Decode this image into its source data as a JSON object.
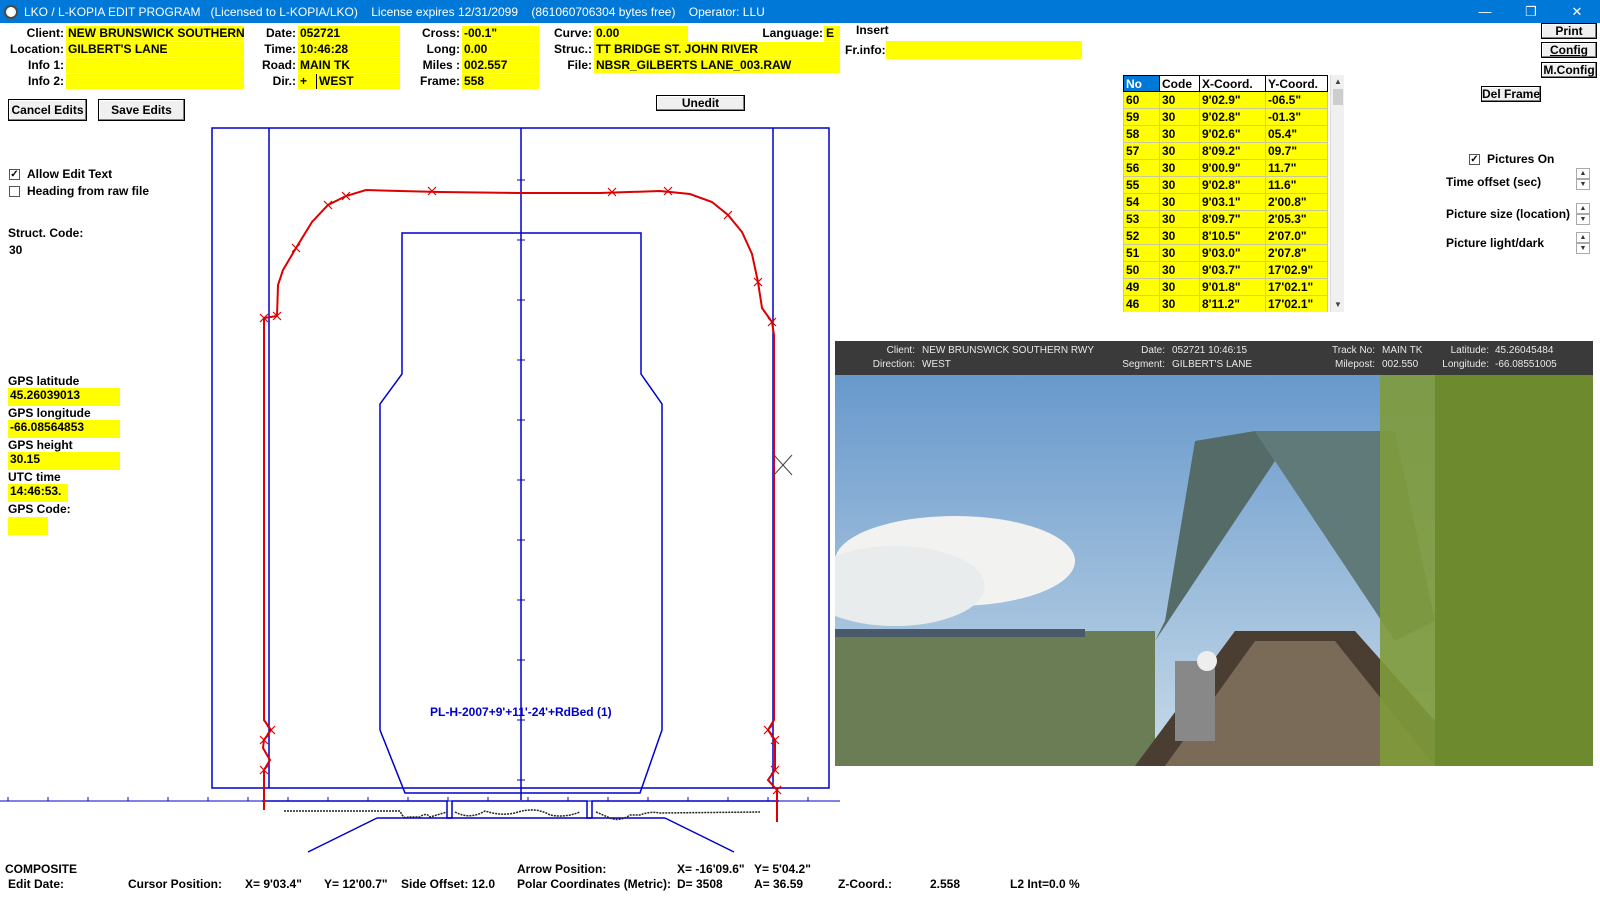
{
  "window": {
    "title": "LKO / L-KOPIA EDIT PROGRAM   (Licensed to L-KOPIA/LKO)    License expires 12/31/2099    (861060706304 bytes free)    Operator: LLU",
    "minimize": "—",
    "restore": "❐",
    "close": "✕"
  },
  "header": {
    "client_label": "Client:",
    "client": "NEW BRUNSWICK SOUTHERN",
    "location_label": "Location:",
    "location": "GILBERT'S LANE",
    "info1_label": "Info 1:",
    "info1": "",
    "info2_label": "Info 2:",
    "info2": "",
    "date_label": "Date:",
    "date": "052721",
    "time_label": "Time:",
    "time": "10:46:28",
    "road_label": "Road:",
    "road": "MAIN TK",
    "dir_label": "Dir.:",
    "dir_sign": "+",
    "dir": "WEST",
    "cross_label": "Cross:",
    "cross": "-00.1\"",
    "long_label": "Long:",
    "long": "0.00",
    "miles_label": "Miles :",
    "miles": "002.557",
    "frame_label": "Frame:",
    "frame": "558",
    "curve_label": "Curve:",
    "curve": "0.00",
    "struc_label": "Struc.:",
    "struc": "TT BRIDGE ST. JOHN RIVER",
    "file_label": "File:",
    "file": "NBSR_GILBERTS LANE_003.RAW",
    "language_label": "Language:",
    "language": "E",
    "insert_label": "Insert",
    "frinfo_label": "Fr.info:",
    "frinfo": ""
  },
  "buttons": {
    "cancel_edits": "Cancel Edits",
    "save_edits": "Save Edits",
    "unedit": "Unedit",
    "print": "Print",
    "config": "Config",
    "mconfig": "M.Config",
    "del_frame": "Del Frame"
  },
  "left_panel": {
    "allow_edit_text": "Allow Edit Text",
    "allow_edit_checked": true,
    "heading_from_raw": "Heading from raw file",
    "heading_checked": false,
    "struct_code_label": "Struct. Code:",
    "struct_code": "30",
    "gps_latitude_label": "GPS latitude",
    "gps_latitude": "45.26039013",
    "gps_longitude_label": "GPS longitude",
    "gps_longitude": "-66.08564853",
    "gps_height_label": "GPS height",
    "gps_height": "30.15",
    "utc_time_label": "UTC time",
    "utc_time": "14:46:53.",
    "gps_code_label": "GPS Code:",
    "gps_code": ""
  },
  "profile": {
    "label": "PL-H-2007+9'+11'-24'+RdBed  (1)",
    "color_measured": "#dd0000",
    "color_clearance": "#0000cc"
  },
  "points_table": {
    "headers": [
      "No",
      "Code",
      "X-Coord.",
      "Y-Coord."
    ],
    "rows": [
      [
        "60",
        "30",
        "9'02.9\"",
        "-06.5\""
      ],
      [
        "59",
        "30",
        "9'02.8\"",
        "-01.3\""
      ],
      [
        "58",
        "30",
        "9'02.6\"",
        "05.4\""
      ],
      [
        "57",
        "30",
        "8'09.2\"",
        "09.7\""
      ],
      [
        "56",
        "30",
        "9'00.9\"",
        "11.7\""
      ],
      [
        "55",
        "30",
        "9'02.8\"",
        "11.6\""
      ],
      [
        "54",
        "30",
        "9'03.1\"",
        "2'00.8\""
      ],
      [
        "53",
        "30",
        "8'09.7\"",
        "2'05.3\""
      ],
      [
        "52",
        "30",
        "8'10.5\"",
        "2'07.0\""
      ],
      [
        "51",
        "30",
        "9'03.0\"",
        "2'07.8\""
      ],
      [
        "50",
        "30",
        "9'03.7\"",
        "17'02.9\""
      ],
      [
        "49",
        "30",
        "9'01.8\"",
        "17'02.1\""
      ],
      [
        "46",
        "30",
        "8'11.2\"",
        "17'02.1\""
      ]
    ]
  },
  "picture_controls": {
    "pictures_on": "Pictures On",
    "pictures_checked": true,
    "time_offset": "Time offset (sec)",
    "picture_size": "Picture size (location)",
    "picture_light": "Picture light/dark"
  },
  "photo_overlay": {
    "client_k": "Client:",
    "client_v": "NEW BRUNSWICK SOUTHERN RWY",
    "direction_k": "Direction:",
    "direction_v": "WEST",
    "date_k": "Date:",
    "date_v": "052721 10:46:15",
    "segment_k": "Segment:",
    "segment_v": "GILBERT'S LANE",
    "track_k": "Track No:",
    "track_v": "MAIN TK",
    "milepost_k": "Milepost:",
    "milepost_v": "002.550",
    "lat_k": "Latitude:",
    "lat_v": "45.26045484",
    "lon_k": "Longitude:",
    "lon_v": "-66.08551005"
  },
  "status": {
    "composite": "COMPOSITE",
    "edit_date": "Edit Date:",
    "cursor_position": "Cursor Position:",
    "cursor_x": "X=  9'03.4\"",
    "cursor_y": "Y= 12'00.7\"",
    "side_offset": "Side Offset:  12.0",
    "arrow_position": "Arrow Position:",
    "arrow_x": "X=  -16'09.6\"",
    "arrow_y": "Y=  5'04.2\"",
    "polar": "Polar Coordinates (Metric):",
    "polar_d": "D=  3508",
    "polar_a": "A=  36.59",
    "z_coord_label": "Z-Coord.:",
    "z_coord": "2.558",
    "l2": "L2 Int=0.0 %"
  }
}
